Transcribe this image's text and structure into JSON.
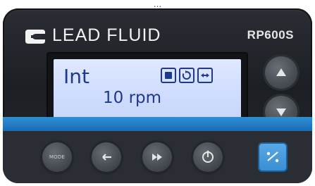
{
  "top_caption": "...",
  "panel": {
    "brand_name": "LEAD FLUID",
    "model": "RP600S"
  },
  "lcd": {
    "mode": "Int",
    "speed": "10 rpm",
    "status_icons": [
      "stop-icon",
      "direction-cw-icon",
      "prime-icon"
    ]
  },
  "buttons": {
    "mode_label": "MODE",
    "side_up": "up-arrow",
    "side_down": "down-arrow",
    "bottom_2": "back-arrow",
    "bottom_3": "fast-forward",
    "bottom_4": "run-stop",
    "bottom_5": "percent-toggle"
  },
  "colors": {
    "accent_blue": "#1b6bb3",
    "lcd_text": "#1f3a8a"
  }
}
